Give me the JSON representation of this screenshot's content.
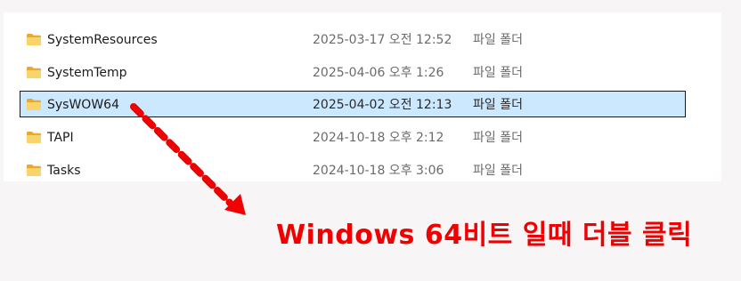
{
  "accent_color": "#ff0000",
  "selection_color": "#cce8ff",
  "folder_icon": "folder-icon",
  "files": [
    {
      "name": "SystemResources",
      "date": "2025-03-17 오전 12:52",
      "type": "파일 폴더",
      "selected": false
    },
    {
      "name": "SystemTemp",
      "date": "2025-04-06 오후 1:26",
      "type": "파일 폴더",
      "selected": false
    },
    {
      "name": "SysWOW64",
      "date": "2025-04-02 오전 12:13",
      "type": "파일 폴더",
      "selected": true
    },
    {
      "name": "TAPI",
      "date": "2024-10-18 오후 2:12",
      "type": "파일 폴더",
      "selected": false
    },
    {
      "name": "Tasks",
      "date": "2024-10-18 오후 3:06",
      "type": "파일 폴더",
      "selected": false
    }
  ],
  "annotation": {
    "text": "Windows 64비트 일때 더블 클릭"
  }
}
